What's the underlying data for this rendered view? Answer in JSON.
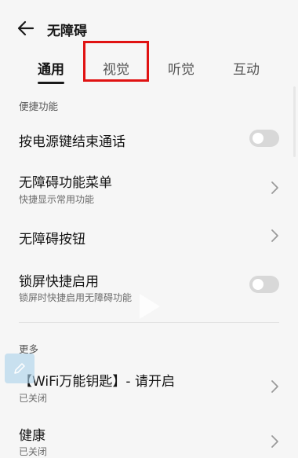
{
  "header": {
    "title": "无障碍"
  },
  "tabs": [
    {
      "label": "通用",
      "active": true
    },
    {
      "label": "视觉",
      "active": false
    },
    {
      "label": "听觉",
      "active": false
    },
    {
      "label": "互动",
      "active": false
    }
  ],
  "sections": {
    "convenience": "便捷功能",
    "more": "更多"
  },
  "items": {
    "power_end_call": {
      "title": "按电源键结束通话",
      "toggle": false
    },
    "a11y_menu": {
      "title": "无障碍功能菜单",
      "subtitle": "快捷显示常用功能"
    },
    "a11y_button": {
      "title": "无障碍按钮"
    },
    "lockscreen_shortcut": {
      "title": "锁屏快捷启用",
      "subtitle": "锁屏时快捷启用无障碍功能",
      "toggle": false
    },
    "wifi_key": {
      "title": "【WiFi万能钥匙】- 请开启",
      "subtitle": "已关闭"
    },
    "health": {
      "title": "健康",
      "subtitle": "已关闭"
    }
  },
  "icons": {
    "back": "back-arrow-icon",
    "chevron": "chevron-right-icon",
    "play": "play-icon",
    "edit": "edit-pencil-icon"
  },
  "colors": {
    "highlight": "#e01212",
    "toggle_off": "#d8d8d8",
    "background": "#f6f6f6"
  }
}
